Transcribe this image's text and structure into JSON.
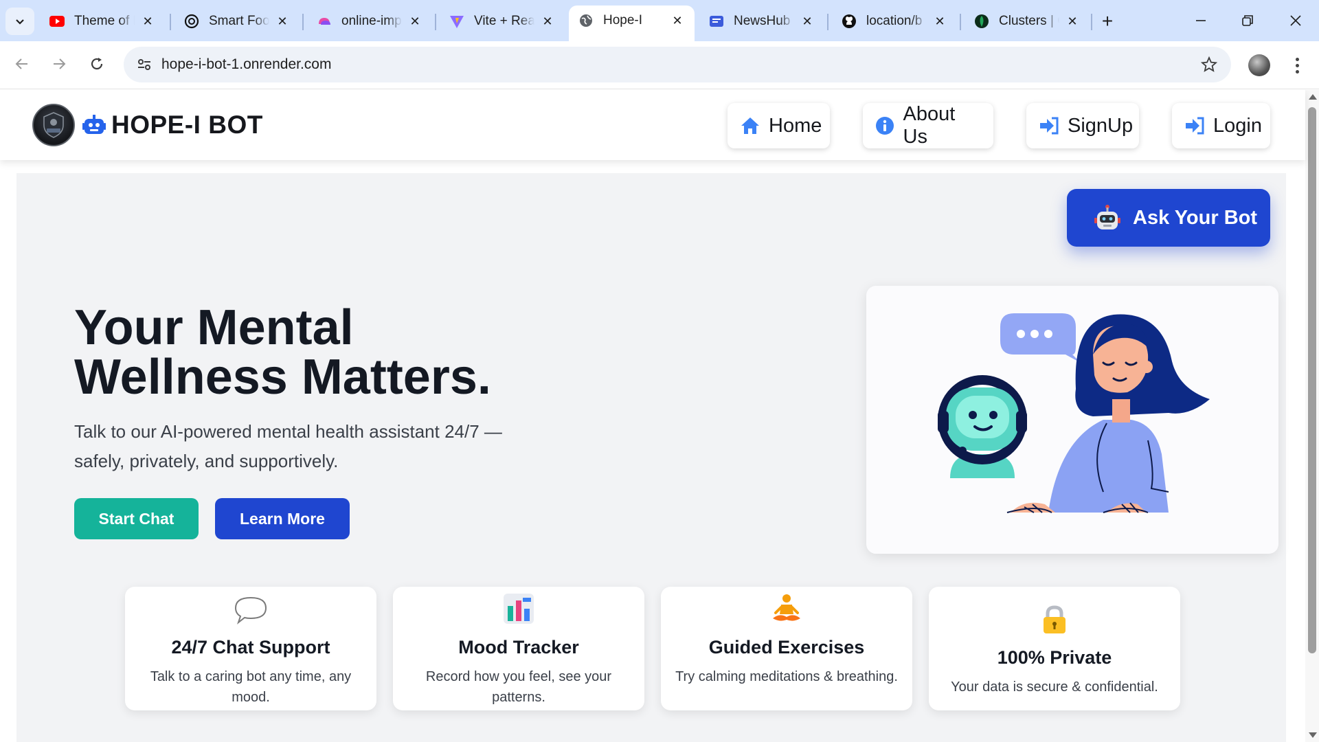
{
  "browser": {
    "tabs": [
      {
        "title": "Theme of H",
        "icon": "youtube-icon"
      },
      {
        "title": "Smart Food",
        "icon": "openai-icon"
      },
      {
        "title": "online-imp",
        "icon": "cloud-drive-icon"
      },
      {
        "title": "Vite + Rea",
        "icon": "vite-icon"
      },
      {
        "title": "Hope-I",
        "icon": "globe-icon",
        "active": true
      },
      {
        "title": "NewsHub",
        "icon": "newspaper-icon"
      },
      {
        "title": "location/b",
        "icon": "github-icon"
      },
      {
        "title": "Clusters | C",
        "icon": "mongodb-leaf-icon"
      }
    ],
    "url": "hope-i-bot-1.onrender.com"
  },
  "header": {
    "brand_name": "HOPE-I BOT",
    "nav": [
      {
        "label": "Home",
        "icon": "home-icon"
      },
      {
        "label": "About Us",
        "icon": "info-circle-icon"
      },
      {
        "label": "SignUp",
        "icon": "sign-in-arrow-icon"
      },
      {
        "label": "Login",
        "icon": "sign-in-arrow-icon"
      }
    ]
  },
  "hero": {
    "ask_button": "Ask Your Bot",
    "title_line1": "Your Mental",
    "title_line2": "Wellness Matters.",
    "subtitle": "Talk to our AI-powered mental health assistant 24/7 — safely, privately, and supportively.",
    "start_button": "Start Chat",
    "learn_button": "Learn More"
  },
  "features": [
    {
      "title": "24/7 Chat Support",
      "desc": "Talk to a caring bot any time, any mood.",
      "icon": "speech-bubble-icon"
    },
    {
      "title": "Mood Tracker",
      "desc": "Record how you feel, see your patterns.",
      "icon": "bar-chart-icon"
    },
    {
      "title": "Guided Exercises",
      "desc": "Try calming meditations & breathing.",
      "icon": "meditation-icon"
    },
    {
      "title": "100% Private",
      "desc": "Your data is secure & confidential.",
      "icon": "padlock-icon"
    }
  ],
  "colors": {
    "primary_blue": "#1f46d0",
    "teal": "#15b39a",
    "hero_bg": "#f2f3f5",
    "chrome_tabbar": "#d3e3fd"
  }
}
